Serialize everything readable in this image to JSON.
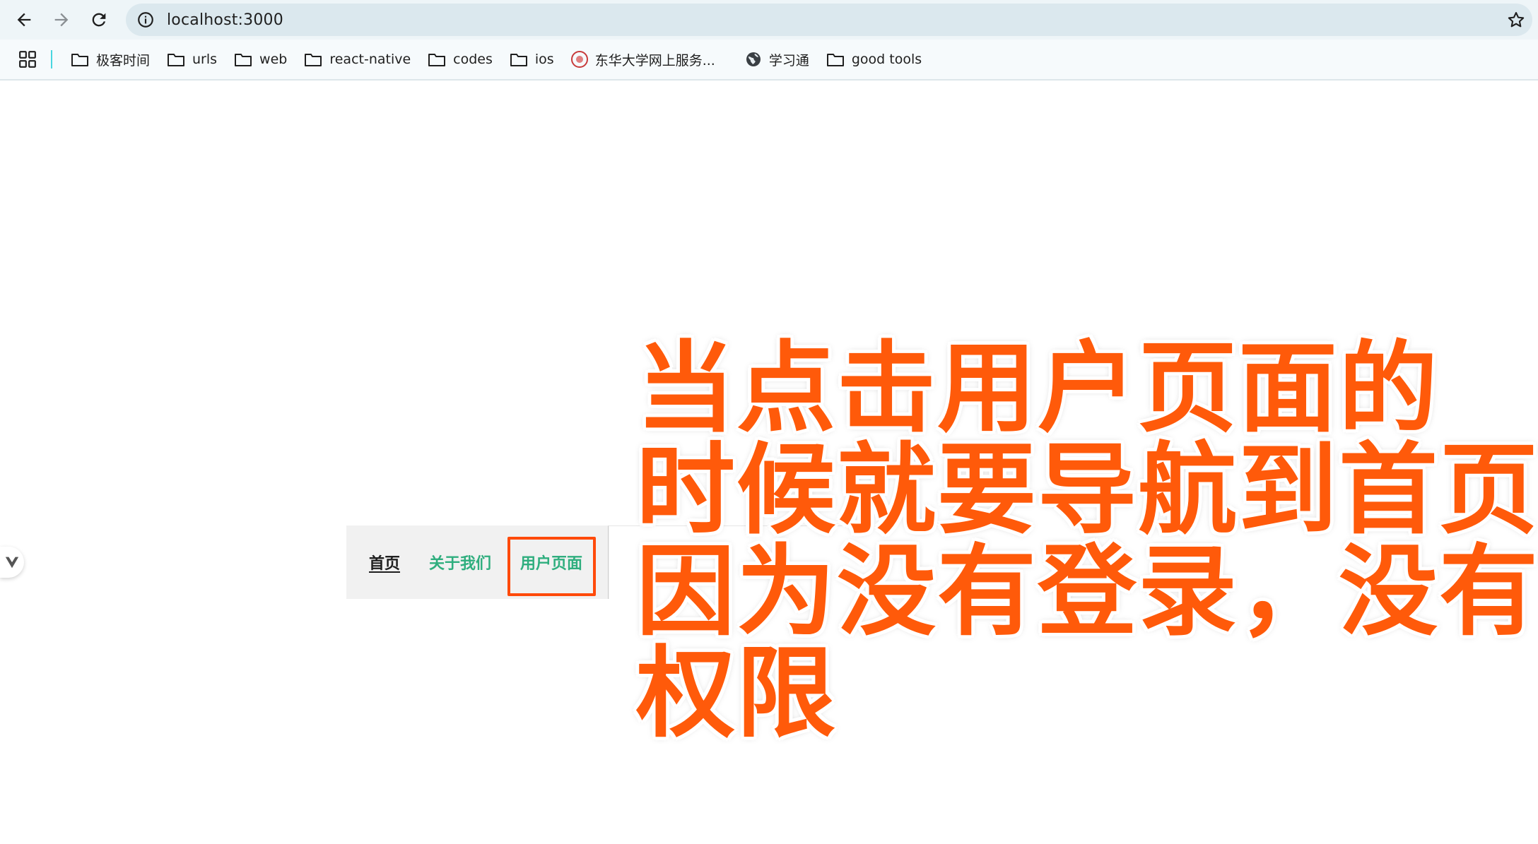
{
  "browser": {
    "url": "localhost:3000",
    "bookmarks": [
      {
        "label": "极客时间",
        "icon": "folder-icon"
      },
      {
        "label": "urls",
        "icon": "folder-icon"
      },
      {
        "label": "web",
        "icon": "folder-icon"
      },
      {
        "label": "react-native",
        "icon": "folder-icon"
      },
      {
        "label": "codes",
        "icon": "folder-icon"
      },
      {
        "label": "ios",
        "icon": "folder-icon"
      },
      {
        "label": "东华大学网上服务...",
        "icon": "university-seal-icon"
      },
      {
        "label": "学习通",
        "icon": "globe-icon"
      },
      {
        "label": "good tools",
        "icon": "folder-icon"
      }
    ]
  },
  "nav": {
    "home": "首页",
    "about": "关于我们",
    "user": "用户页面"
  },
  "annotation": {
    "lines": [
      "当点击用户页面的",
      "时候就要导航到首页",
      "因为没有登录，没有",
      "权限"
    ]
  },
  "colors": {
    "annotation": "#ff5a0a",
    "link_active": "#2fae7e",
    "highlight_border": "#ff4a0a"
  }
}
